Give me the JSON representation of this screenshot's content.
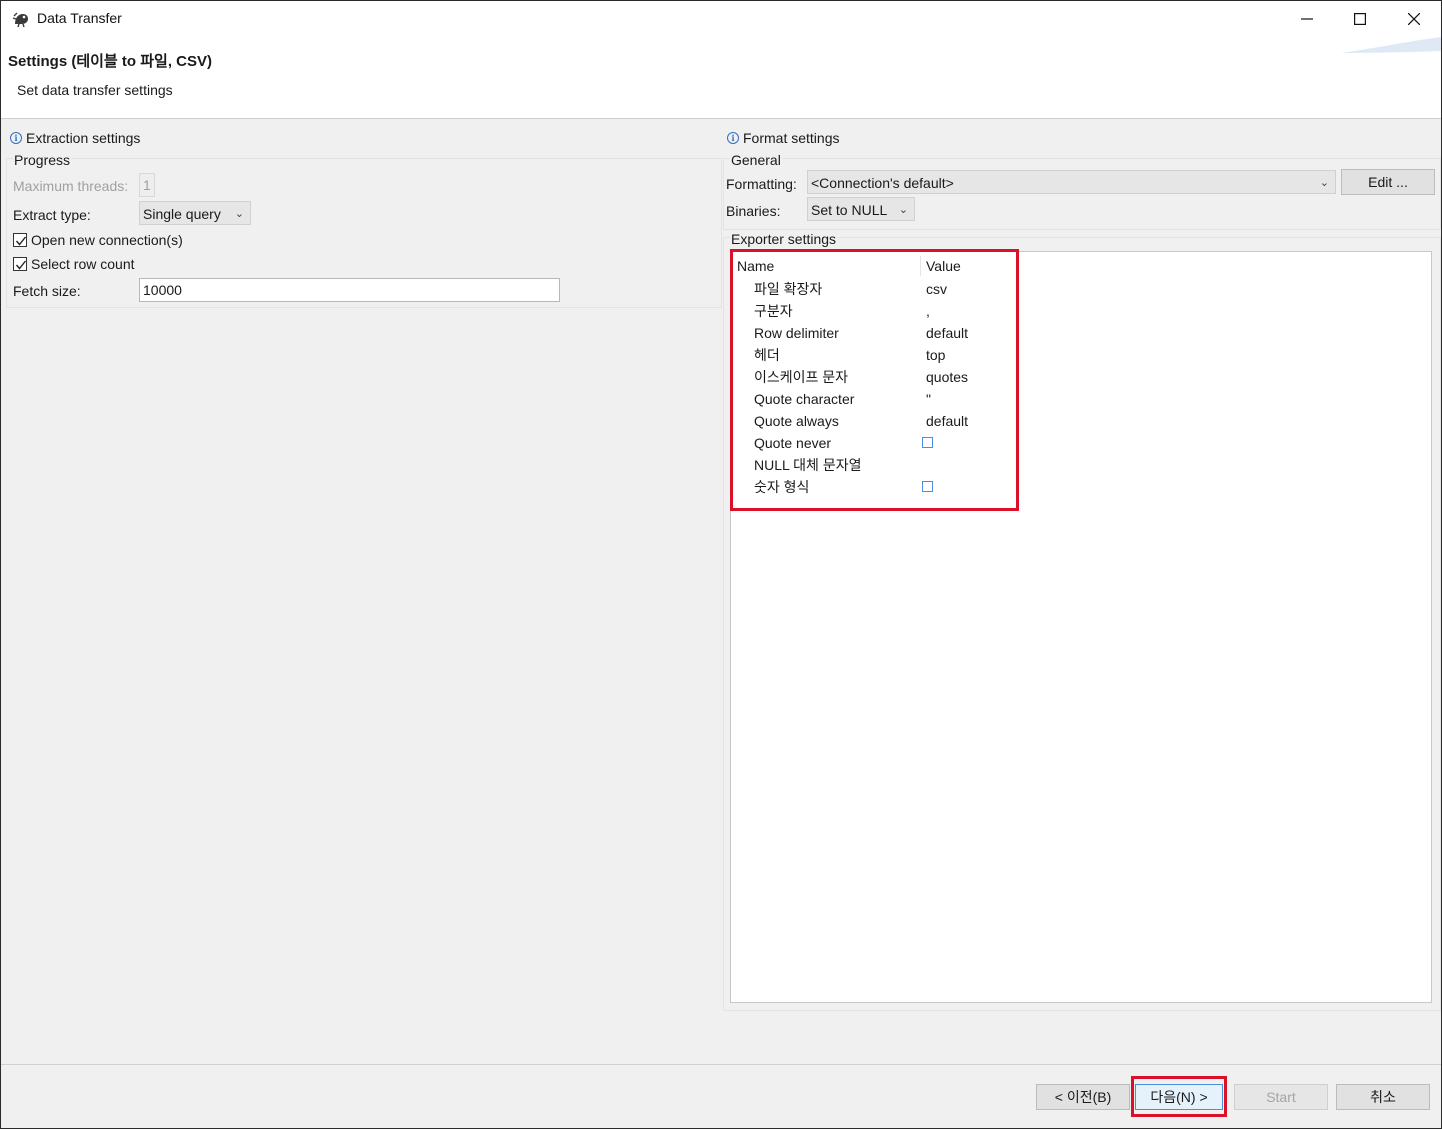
{
  "window": {
    "title": "Data Transfer"
  },
  "header": {
    "title": "Settings (테이블 to 파일, CSV)",
    "description": "Set data transfer settings"
  },
  "extraction": {
    "heading": "Extraction settings",
    "group_label": "Progress",
    "max_threads_label": "Maximum threads:",
    "max_threads_value": "1",
    "extract_type_label": "Extract type:",
    "extract_type_value": "Single query",
    "open_new_connection_label": "Open new connection(s)",
    "open_new_connection_checked": true,
    "select_row_count_label": "Select row count",
    "select_row_count_checked": true,
    "fetch_size_label": "Fetch size:",
    "fetch_size_value": "10000"
  },
  "format": {
    "heading": "Format settings",
    "general_label": "General",
    "formatting_label": "Formatting:",
    "formatting_value": "<Connection's default>",
    "edit_button": "Edit ...",
    "binaries_label": "Binaries:",
    "binaries_value": "Set to NULL",
    "exporter_label": "Exporter settings",
    "columns": {
      "name": "Name",
      "value": "Value"
    },
    "properties": [
      {
        "name": "파일 확장자",
        "value": "csv",
        "type": "text"
      },
      {
        "name": "구분자",
        "value": ",",
        "type": "text"
      },
      {
        "name": "Row delimiter",
        "value": "default",
        "type": "text"
      },
      {
        "name": "헤더",
        "value": "top",
        "type": "text"
      },
      {
        "name": "이스케이프 문자",
        "value": "quotes",
        "type": "text"
      },
      {
        "name": "Quote character",
        "value": "\"",
        "type": "text"
      },
      {
        "name": "Quote always",
        "value": "default",
        "type": "text"
      },
      {
        "name": "Quote never",
        "value": "",
        "type": "checkbox",
        "checked": false
      },
      {
        "name": "NULL 대체 문자열",
        "value": "",
        "type": "text"
      },
      {
        "name": "숫자 형식",
        "value": "",
        "type": "checkbox",
        "checked": false
      }
    ]
  },
  "footer": {
    "back_button": "< 이전(B)",
    "next_button": "다음(N) >",
    "start_button": "Start",
    "cancel_button": "취소"
  },
  "colors": {
    "highlight": "#d9122a",
    "info_icon": "#2f6fc2",
    "checkbox_border": "#4a8fd9"
  },
  "icons": [
    "dbeaver-logo-icon",
    "minimize-icon",
    "maximize-icon",
    "close-icon",
    "info-icon",
    "chevron-down-icon",
    "checkmark-icon"
  ]
}
